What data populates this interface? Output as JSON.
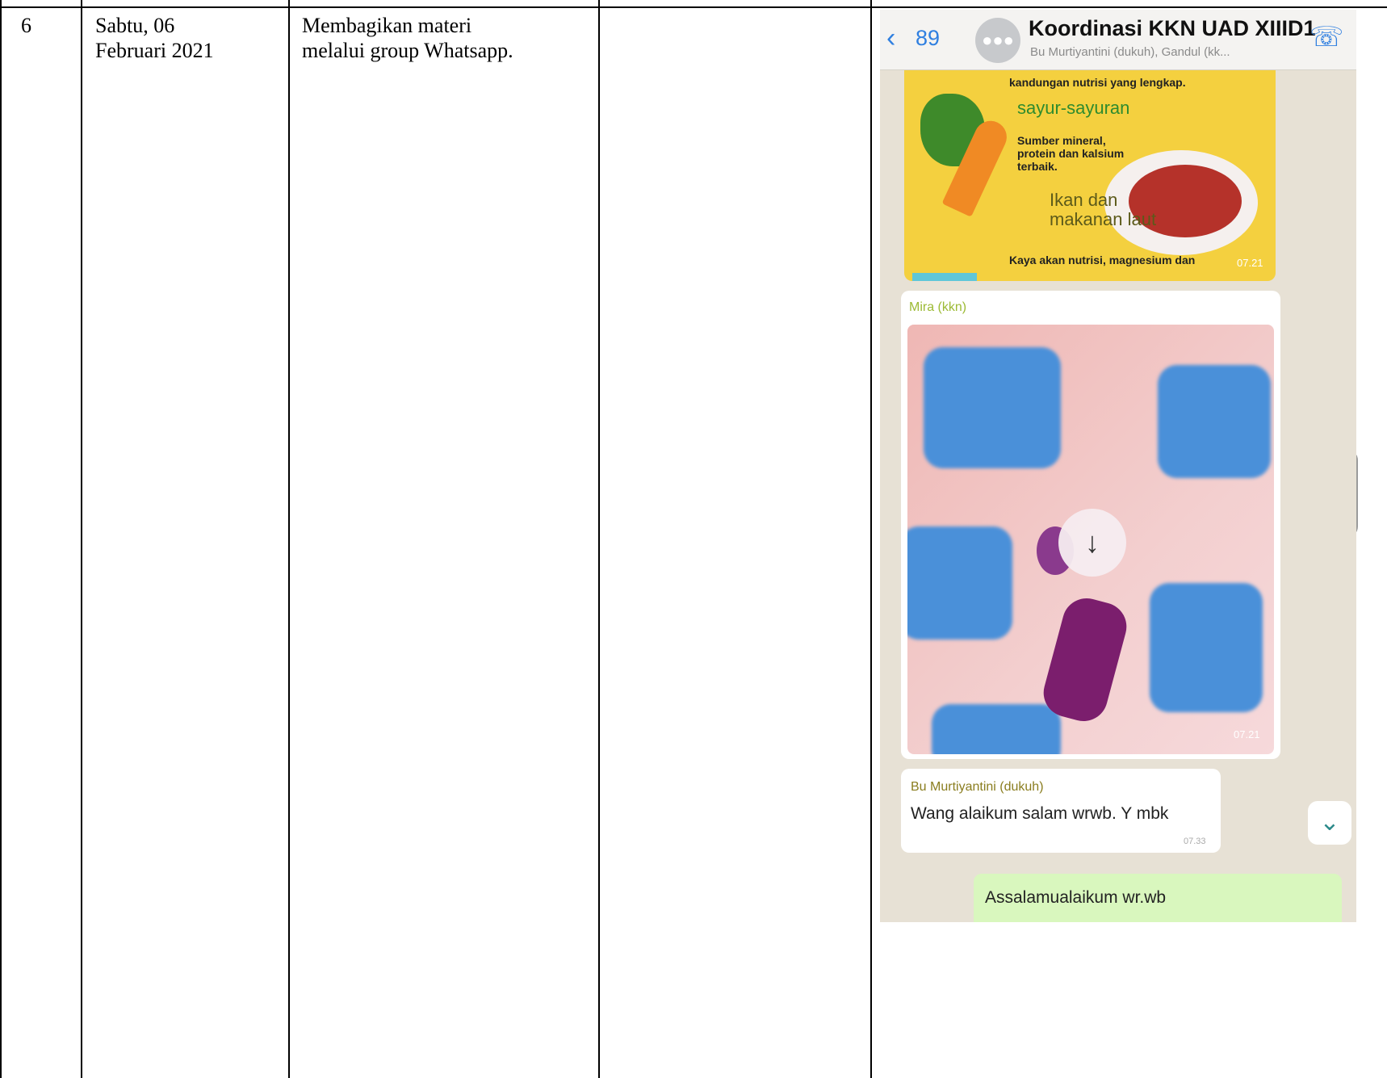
{
  "row": {
    "number": "6",
    "date": "Sabtu, 06\nFebruari 2021",
    "activity": "Membagikan materi\nmelalui group Whatsapp.",
    "notes": ""
  },
  "whatsapp": {
    "back_count": "89",
    "group_name": "Koordinasi KKN UAD XIIID1",
    "members_preview": "Bu Murtiyantini (dukuh), Gandul (kk...",
    "image1": {
      "caption_top": "kandungan nutrisi yang lengkap.",
      "heading_veg": "sayur-sayuran",
      "veg_text": "Sumber mineral,\nprotein dan kalsium\nterbaik.",
      "heading_fish": "Ikan dan\nmakanan laut",
      "fish_text": "Kaya akan nutrisi, magnesium dan",
      "time": "07.21"
    },
    "bubble2": {
      "sender": "Mira (kkn)",
      "time": "07.21"
    },
    "bubble3": {
      "sender": "Bu Murtiyantini (dukuh)",
      "text": "Wang alaikum salam wrwb. Y mbk",
      "time": "07.33"
    },
    "bubble4": {
      "text": "Assalamualaikum wr.wb"
    },
    "colors": {
      "ios_blue": "#2f7fe0",
      "sender_green": "#9cba34",
      "sender_olive": "#8a7d1f",
      "outgoing_bubble": "#d9f7be",
      "chat_background": "#e7e1d5"
    }
  }
}
